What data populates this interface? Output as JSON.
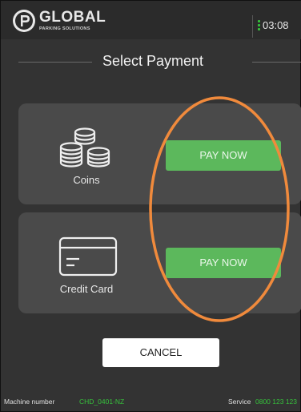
{
  "header": {
    "logo_name": "GLOBAL",
    "logo_tagline": "PARKING SOLUTIONS",
    "time": "03:08"
  },
  "title": "Select Payment",
  "options": [
    {
      "label": "Coins",
      "icon": "coins-icon",
      "button_label": "PAY NOW"
    },
    {
      "label": "Credit Card",
      "icon": "credit-card-icon",
      "button_label": "PAY NOW"
    }
  ],
  "cancel_label": "CANCEL",
  "footer": {
    "machine_label": "Machine number",
    "machine_value": "CHD_0401-NZ",
    "service_label": "Service",
    "service_value": "0800 123 123"
  },
  "colors": {
    "background": "#333333",
    "card": "#4a4a4a",
    "pay_button": "#5cb85c",
    "accent_green": "#36c23c",
    "annotation": "#f08a3c"
  }
}
